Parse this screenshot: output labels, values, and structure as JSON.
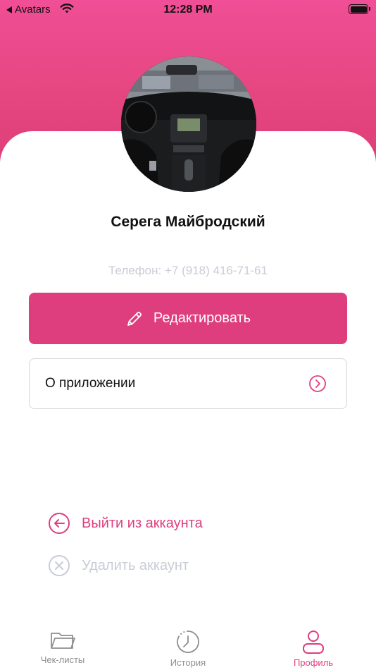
{
  "status_bar": {
    "back_label": "Avatars",
    "time": "12:28 PM"
  },
  "profile": {
    "name": "Серега Майбродский",
    "phone": "Телефон: +7 (918) 416-71-61"
  },
  "buttons": {
    "edit_label": "Редактировать",
    "about_label": "О приложении",
    "logout_label": "Выйти из аккаунта",
    "delete_label": "Удалить аккаунт"
  },
  "tabbar": {
    "tabs": [
      {
        "label": "Чек-листы",
        "icon": "folder-icon"
      },
      {
        "label": "История",
        "icon": "history-icon"
      },
      {
        "label": "Профиль",
        "icon": "profile-icon",
        "active": true
      }
    ]
  },
  "colors": {
    "accent": "#de3e7d",
    "header_gradient_top": "#f04e96",
    "muted_text": "#c9ccd6"
  }
}
